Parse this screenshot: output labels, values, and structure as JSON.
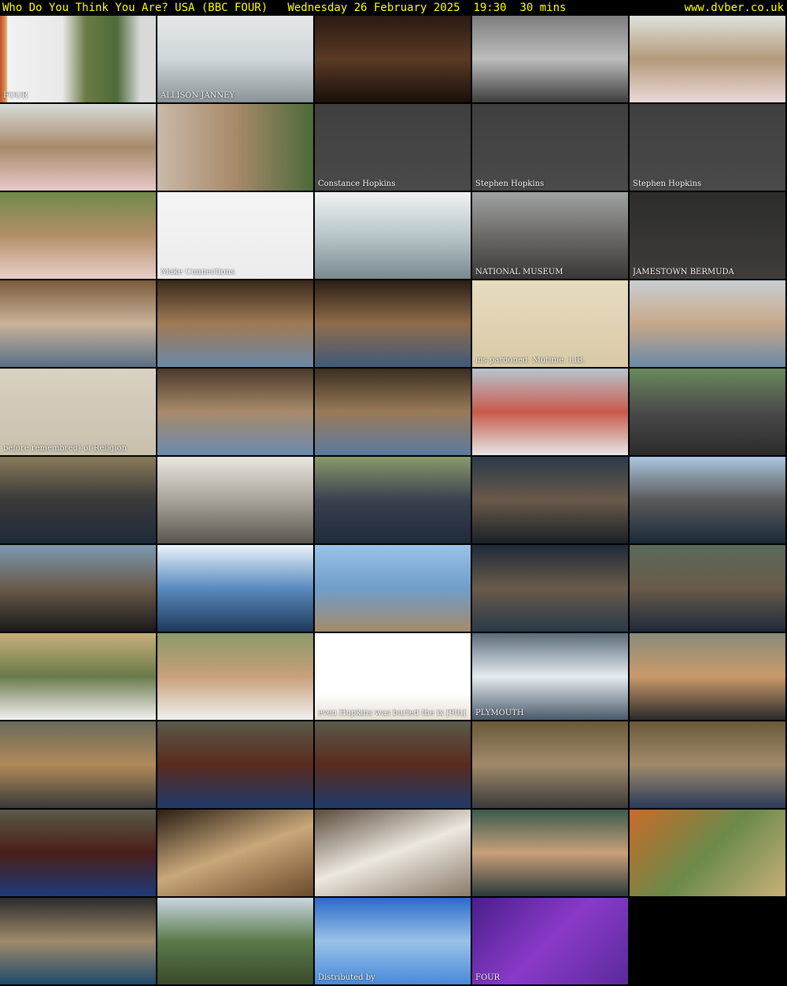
{
  "header": {
    "title": "Who Do You Think You Are? USA (BBC FOUR)   Wednesday 26 February 2025  19:30  30 mins",
    "site": "www.dvber.co.uk"
  },
  "thumbnails": [
    {
      "caption": "FOUR",
      "bg": "linear-gradient(90deg,#c44a2a 0%,#d9a35a 4%,#f2f2f2 5%,#e9e9e9 40%,#6c7a45 55%,#4e6b3a 75%,#d9d9d9 90%)"
    },
    {
      "caption": "ALLISON JANNEY",
      "bg": "linear-gradient(180deg,#e5e8ea 0%,#cfd6d9 50%,#8a9397 100%)"
    },
    {
      "caption": "",
      "bg": "linear-gradient(180deg,#2b1a12 0%,#5a3a25 50%,#1a0f0a 100%)"
    },
    {
      "caption": "",
      "bg": "linear-gradient(180deg,#7d7d7d 0%,#bdbdbd 50%,#3e3e3e 100%)"
    },
    {
      "caption": "",
      "bg": "linear-gradient(180deg,#dfe2dc 0%,#b49a7a 50%,#ead8d8 100%)"
    },
    {
      "caption": "",
      "bg": "linear-gradient(180deg,#d8dcd9 0%,#a88a6a 50%,#e8c9c9 100%)"
    },
    {
      "caption": "",
      "bg": "linear-gradient(90deg,#c9b9a8 0%,#a88a6a 50%,#4c6a3a 100%)"
    },
    {
      "caption": "Constance Hopkins",
      "bg": "linear-gradient(180deg,#3f3f3f 0%,#4a4a4a 100%)"
    },
    {
      "caption": "Stephen Hopkins",
      "bg": "linear-gradient(180deg,#3f3f3f 0%,#4a4a4a 100%)"
    },
    {
      "caption": "Stephen Hopkins",
      "bg": "linear-gradient(180deg,#3f3f3f 0%,#4a4a4a 100%)"
    },
    {
      "caption": "",
      "bg": "linear-gradient(180deg,#6f8a4a 0%,#b48f68 50%,#e9cfc9 100%)"
    },
    {
      "caption": "Make Connections",
      "bg": "linear-gradient(180deg,#f5f5f5 0%,#ececec 100%)"
    },
    {
      "caption": "",
      "bg": "linear-gradient(180deg,#f0f2f2 0%,#b8c6c9 50%,#7a8a92 100%)"
    },
    {
      "caption": "NATIONAL MUSEUM",
      "bg": "linear-gradient(180deg,#9fa3a3 0%,#6c6a66 50%,#3a3836 100%)"
    },
    {
      "caption": "JAMESTOWN   BERMUDA",
      "bg": "linear-gradient(180deg,#2c2c2a 0%,#3e3d3a 100%)"
    },
    {
      "caption": "",
      "bg": "linear-gradient(180deg,#7b5a3a 0%,#c9b49a 50%,#5a6e86 100%)"
    },
    {
      "caption": "",
      "bg": "linear-gradient(180deg,#3a2a1a 0%,#a07a55 50%,#6a88a8 100%)"
    },
    {
      "caption": "",
      "bg": "linear-gradient(180deg,#2a1e14 0%,#8f6c4a 50%,#3e5a7a 100%)"
    },
    {
      "caption": "ins pardoned. Mutinie. LIB.",
      "bg": "linear-gradient(180deg,#e8dcc0 0%,#d9caa6 100%)"
    },
    {
      "caption": "",
      "bg": "linear-gradient(180deg,#c9cfd2 0%,#c7a889 50%,#6a8aa8 100%)"
    },
    {
      "caption": "before remembred) of Religion",
      "bg": "linear-gradient(180deg,#d9d2c2 0%,#c9c0ac 100%)"
    },
    {
      "caption": "",
      "bg": "linear-gradient(180deg,#4a3a2a 0%,#a88a6a 50%,#6a8ab0 100%)"
    },
    {
      "caption": "",
      "bg": "linear-gradient(180deg,#3a2e22 0%,#9a7a58 50%,#5a7aa0 100%)"
    },
    {
      "caption": "",
      "bg": "linear-gradient(180deg,#b8c4d0 0%,#c85a4a 50%,#e6e6e6 100%)"
    },
    {
      "caption": "",
      "bg": "linear-gradient(180deg,#6a8a5a 0%,#4a4a4a 50%,#2a2a2a 100%)"
    },
    {
      "caption": "",
      "bg": "linear-gradient(180deg,#8a7a5a 0%,#3a3a3a 50%,#1e2a3a 100%)"
    },
    {
      "caption": "",
      "bg": "linear-gradient(180deg,#e9e6df 0%,#a9a49a 50%,#5a564e 100%)"
    },
    {
      "caption": "",
      "bg": "linear-gradient(180deg,#8a9a6a 0%,#3a4050 50%,#1e2a3a 100%)"
    },
    {
      "caption": "",
      "bg": "linear-gradient(180deg,#2a3a4a 0%,#6a5a4a 50%,#1a2028 100%)"
    },
    {
      "caption": "",
      "bg": "linear-gradient(180deg,#aac6e0 0%,#5a5a5a 50%,#1a2a3a 100%)"
    },
    {
      "caption": "",
      "bg": "linear-gradient(180deg,#7a9ab0 0%,#6a5a4a 50%,#1a1a1a 100%)"
    },
    {
      "caption": "",
      "bg": "linear-gradient(180deg,#e9f3fb 0%,#5a8abf 50%,#1e3a5a 100%)"
    },
    {
      "caption": "",
      "bg": "linear-gradient(180deg,#9ac2e8 0%,#6f9ec9 50%,#a58a6a 100%)"
    },
    {
      "caption": "",
      "bg": "linear-gradient(180deg,#1e2a38 0%,#6a5a4a 50%,#2a3a48 100%)"
    },
    {
      "caption": "",
      "bg": "linear-gradient(180deg,#5a6a5a 0%,#6a5a4a 50%,#1e2a3a 100%)"
    },
    {
      "caption": "",
      "bg": "linear-gradient(180deg,#c9b07a 0%,#6a7a4a 50%,#f2f2f2 100%)"
    },
    {
      "caption": "",
      "bg": "linear-gradient(180deg,#8a9a6a 0%,#c9a07a 50%,#f0f0f0 100%)"
    },
    {
      "caption": "even Hopkins was buried the ix [9th] day of May.",
      "bg": "linear-gradient(180deg,#ffffff 0%,#ffffff 70%,#e6e0d4 100%)"
    },
    {
      "caption": "PLYMOUTH",
      "bg": "linear-gradient(180deg,#5a6a7a 0%,#e6ecf0 50%,#4a5a6a 100%)"
    },
    {
      "caption": "",
      "bg": "linear-gradient(180deg,#8a8a7a 0%,#c99a6a 50%,#2a2a2a 100%)"
    },
    {
      "caption": "",
      "bg": "linear-gradient(180deg,#6a6a5a 0%,#b08a5a 50%,#3a3a3a 100%)"
    },
    {
      "caption": "",
      "bg": "linear-gradient(180deg,#5a5a4a 0%,#5a2a1e 50%,#1e3a6a 100%)"
    },
    {
      "caption": "",
      "bg": "linear-gradient(180deg,#5a5a4a 0%,#5a2a1e 50%,#1e3a6a 100%)"
    },
    {
      "caption": "",
      "bg": "linear-gradient(180deg,#6a5a3a 0%,#a08a6a 50%,#3a3a3a 100%)"
    },
    {
      "caption": "",
      "bg": "linear-gradient(180deg,#6a5a3a 0%,#a08a6a 50%,#2a3a5a 100%)"
    },
    {
      "caption": "",
      "bg": "linear-gradient(180deg,#5a5a4a 0%,#4a1e18 50%,#1e3a7a 100%)"
    },
    {
      "caption": "",
      "bg": "linear-gradient(160deg,#2a1e14 0%,#c9a87a 50%,#6a4a2a 100%)"
    },
    {
      "caption": "",
      "bg": "linear-gradient(160deg,#5a4a3a 0%,#ece8e0 50%,#8a7a6a 100%)"
    },
    {
      "caption": "",
      "bg": "linear-gradient(180deg,#3a5a4a 0%,#c9a07a 50%,#2a3a3a 100%)"
    },
    {
      "caption": "",
      "bg": "linear-gradient(135deg,#c96a2a 0%,#6a8a4a 50%,#c9b07a 100%)"
    },
    {
      "caption": "",
      "bg": "linear-gradient(180deg,#2a2a2a 0%,#a08a6a 50%,#1e4a6a 100%)"
    },
    {
      "caption": "",
      "bg": "linear-gradient(180deg,#c9d6e0 0%,#5a7a4a 50%,#3a4a2a 100%)"
    },
    {
      "caption": "Distributed by",
      "bg": "linear-gradient(180deg,#2a6ac9 0%,#9ac2e8 50%,#4a8ad9 100%)"
    },
    {
      "caption": "FOUR",
      "bg": "linear-gradient(135deg,#4a1e8a 0%,#8a3ac9 50%,#5a2a9a 100%)"
    },
    {
      "caption": "",
      "bg": "#000000"
    }
  ]
}
